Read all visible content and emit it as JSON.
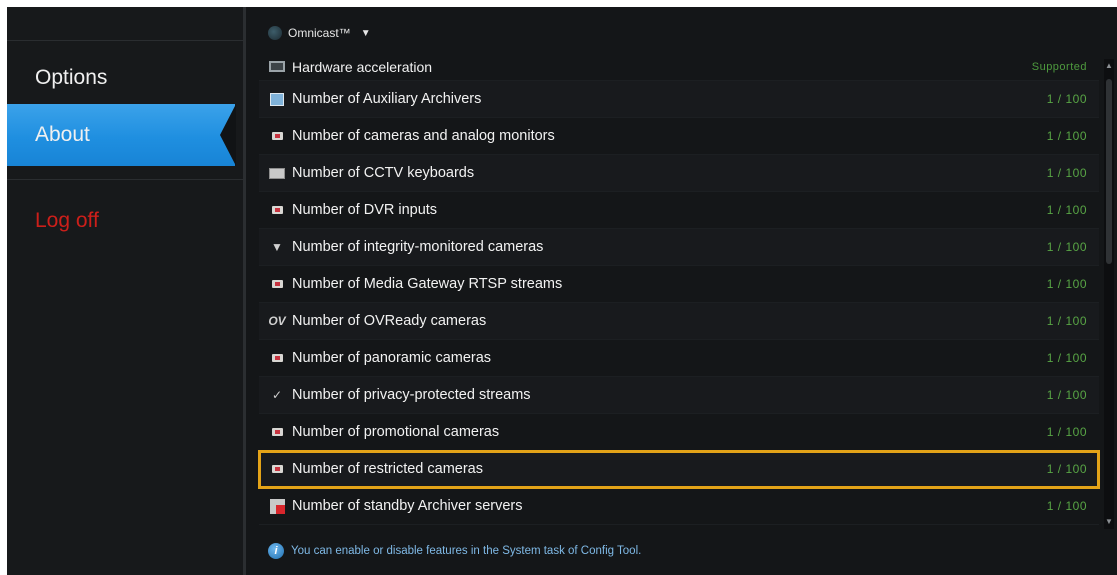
{
  "sidebar": {
    "items": [
      {
        "label": "Options"
      },
      {
        "label": "About"
      },
      {
        "label": "Log off"
      }
    ]
  },
  "header": {
    "product": "Omnicast™"
  },
  "features": [
    {
      "icon": "hardware-icon",
      "label": "Hardware acceleration",
      "value": "Supported"
    },
    {
      "icon": "auxiliary-archiver-icon",
      "label": "Number of Auxiliary Archivers",
      "value": "1 / 100"
    },
    {
      "icon": "camera-icon",
      "label": "Number of cameras and analog monitors",
      "value": "1 / 100"
    },
    {
      "icon": "keyboard-icon",
      "label": "Number of CCTV keyboards",
      "value": "1 / 100"
    },
    {
      "icon": "camera-icon",
      "label": "Number of DVR inputs",
      "value": "1 / 100"
    },
    {
      "icon": "integrity-camera-icon",
      "label": "Number of integrity-monitored cameras",
      "value": "1 / 100"
    },
    {
      "icon": "camera-icon",
      "label": "Number of Media Gateway RTSP streams",
      "value": "1 / 100"
    },
    {
      "icon": "ovready-icon",
      "label": "Number of OVReady cameras",
      "value": "1 / 100"
    },
    {
      "icon": "camera-icon",
      "label": "Number of panoramic cameras",
      "value": "1 / 100"
    },
    {
      "icon": "privacy-icon",
      "label": "Number of privacy-protected streams",
      "value": "1 / 100"
    },
    {
      "icon": "camera-icon",
      "label": "Number of promotional cameras",
      "value": "1 / 100"
    },
    {
      "icon": "camera-icon",
      "label": "Number of restricted cameras",
      "value": "1 / 100"
    },
    {
      "icon": "standby-archiver-icon",
      "label": "Number of standby Archiver servers",
      "value": "1 / 100"
    }
  ],
  "footer": {
    "text": "You can enable or disable features in the System task of Config Tool."
  },
  "colors": {
    "accent": "#1f8fe0",
    "logoff": "#cc1f1a",
    "value": "#58a545",
    "highlight": "#e3a318"
  }
}
